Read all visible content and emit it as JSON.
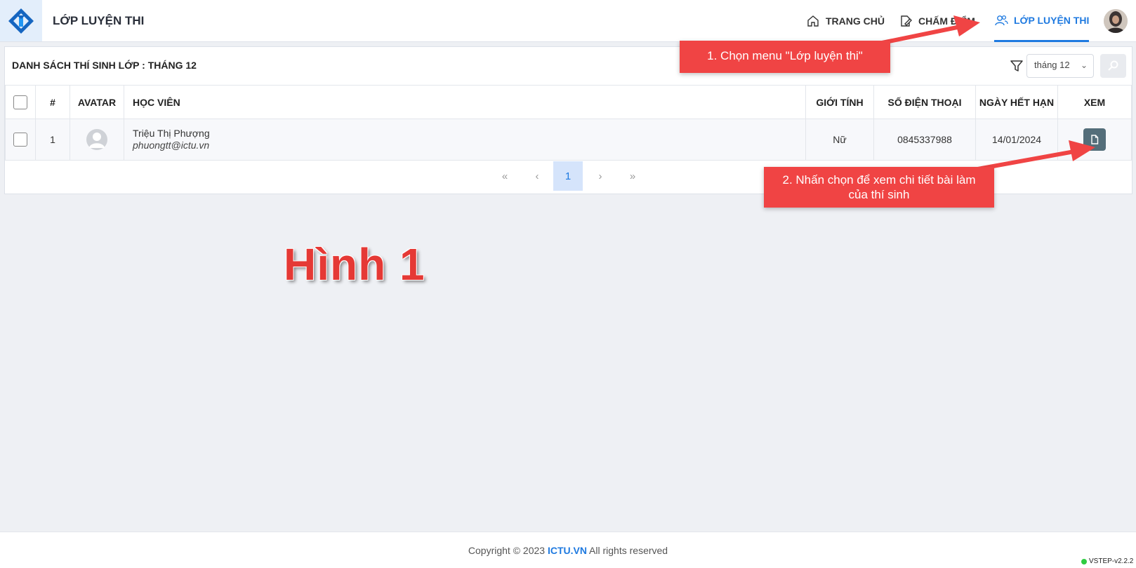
{
  "header": {
    "title": "LỚP LUYỆN THI",
    "nav": [
      {
        "label": "TRANG CHỦ",
        "icon": "home-icon"
      },
      {
        "label": "CHẤM ĐIỂM",
        "icon": "edit-icon"
      },
      {
        "label": "LỚP LUYỆN THI",
        "icon": "users-icon",
        "active": true
      }
    ]
  },
  "card": {
    "title": "DANH SÁCH THÍ SINH LỚP : THÁNG 12",
    "filter": {
      "selected": "tháng 12"
    }
  },
  "table": {
    "columns": [
      "#",
      "AVATAR",
      "HỌC VIÊN",
      "GIỚI TÍNH",
      "SỐ ĐIỆN THOẠI",
      "NGÀY HẾT HẠN",
      "XEM"
    ],
    "rows": [
      {
        "index": "1",
        "name": "Triệu Thị Phượng",
        "email": "phuongtt@ictu.vn",
        "gender": "Nữ",
        "phone": "0845337988",
        "expiry": "14/01/2024"
      }
    ]
  },
  "pagination": {
    "current": "1",
    "first": "«",
    "prev": "‹",
    "next": "›",
    "last": "»"
  },
  "annotations": {
    "callout1": "1. Chọn menu \"Lớp luyện thi\"",
    "callout2_line1": "2. Nhấn chọn để xem chi tiết bài làm",
    "callout2_line2": "của thí sinh",
    "figure_label": "Hình 1"
  },
  "footer": {
    "prefix": "Copyright © 2023 ",
    "brand": "ICTU.VN",
    "suffix": " All rights reserved",
    "version": "VSTEP-v2.2.2"
  },
  "colors": {
    "accent": "#1f7ae0",
    "callout": "#f04444",
    "view_button": "#546e7a"
  }
}
